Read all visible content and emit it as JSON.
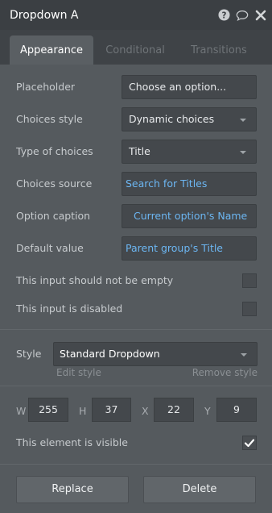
{
  "window": {
    "title": "Dropdown A"
  },
  "tabs": [
    {
      "label": "Appearance",
      "active": true
    },
    {
      "label": "Conditional",
      "active": false
    },
    {
      "label": "Transitions",
      "active": false
    }
  ],
  "fields": {
    "placeholder": {
      "label": "Placeholder",
      "value": "Choose an option..."
    },
    "choices_style": {
      "label": "Choices style",
      "value": "Dynamic choices"
    },
    "type_of_choices": {
      "label": "Type of choices",
      "value": "Title"
    },
    "choices_source": {
      "label": "Choices source",
      "value": "Search for Titles"
    },
    "option_caption": {
      "label": "Option caption",
      "value": "Current option's Name"
    },
    "default_value": {
      "label": "Default value",
      "value": "Parent group's Title"
    }
  },
  "checks": {
    "not_empty": {
      "label": "This input should not be empty",
      "checked": false
    },
    "disabled": {
      "label": "This input is disabled",
      "checked": false
    }
  },
  "style": {
    "label": "Style",
    "value": "Standard Dropdown",
    "edit_label": "Edit style",
    "remove_label": "Remove style"
  },
  "geometry": {
    "w_label": "W",
    "w": "255",
    "h_label": "H",
    "h": "37",
    "x_label": "X",
    "x": "22",
    "y_label": "Y",
    "y": "9"
  },
  "visibility": {
    "label": "This element is visible",
    "checked": true
  },
  "buttons": {
    "replace": "Replace",
    "delete": "Delete"
  },
  "icons": {
    "help": "help-icon",
    "comment": "comment-icon",
    "close": "close-icon",
    "check": "checkmark-icon",
    "caret": "chevron-down-icon"
  },
  "colors": {
    "link": "#6cb6f2",
    "titlebar": "#3b3f43",
    "panel": "#555a5e"
  }
}
